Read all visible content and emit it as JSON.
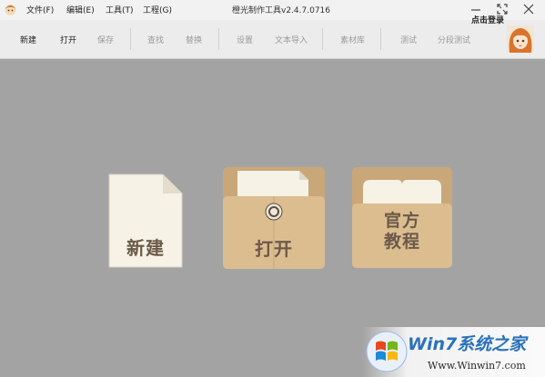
{
  "window": {
    "title": "橙光制作工具v2.4.7.0716",
    "menu": [
      "文件(F)",
      "编辑(E)",
      "工具(T)",
      "工程(G)"
    ]
  },
  "toolbar": {
    "items": [
      {
        "label": "新建",
        "enabled": true
      },
      {
        "label": "打开",
        "enabled": true
      },
      {
        "label": "保存",
        "enabled": false
      },
      {
        "label": "查找",
        "enabled": false
      },
      {
        "label": "替换",
        "enabled": false
      },
      {
        "label": "设置",
        "enabled": false
      },
      {
        "label": "文本导入",
        "enabled": false
      },
      {
        "label": "素材库",
        "enabled": false
      },
      {
        "label": "测试",
        "enabled": false
      },
      {
        "label": "分段测试",
        "enabled": false
      }
    ],
    "login_label": "点击登录"
  },
  "tiles": {
    "new_label": "新建",
    "open_label": "打开",
    "tutorial_label_line1": "官方",
    "tutorial_label_line2": "教程"
  },
  "watermark": {
    "text": "Win7系统之家",
    "url": "Www.Winwin7.com"
  },
  "colors": {
    "background": "#a3a3a3",
    "tile_tan": "#d9b98c",
    "tile_label": "#6b5a49",
    "paper": "#f6f2e6"
  }
}
